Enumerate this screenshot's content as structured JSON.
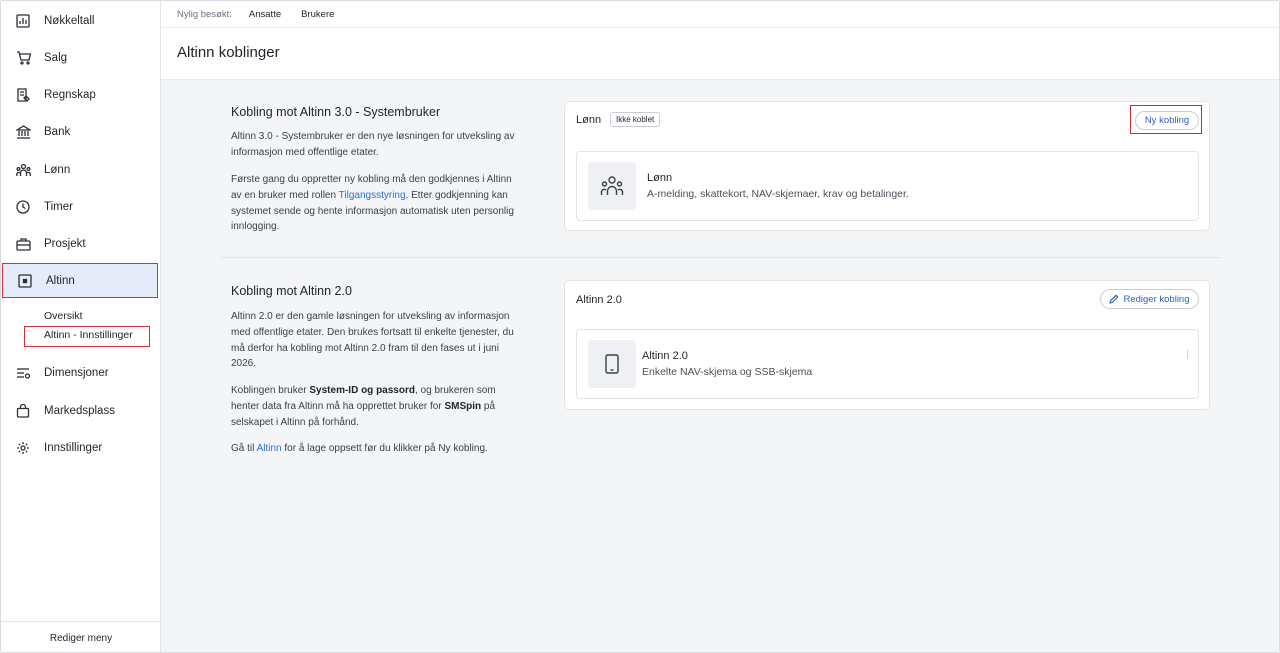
{
  "sidebar": {
    "items": [
      {
        "label": "Nøkkeltall",
        "icon": "bar-chart-icon"
      },
      {
        "label": "Salg",
        "icon": "cart-icon"
      },
      {
        "label": "Regnskap",
        "icon": "ledger-icon"
      },
      {
        "label": "Bank",
        "icon": "bank-icon"
      },
      {
        "label": "Lønn",
        "icon": "people-icon"
      },
      {
        "label": "Timer",
        "icon": "clock-icon"
      },
      {
        "label": "Prosjekt",
        "icon": "briefcase-icon"
      },
      {
        "label": "Altinn",
        "icon": "altinn-icon"
      },
      {
        "label": "Dimensjoner",
        "icon": "dimensions-icon"
      },
      {
        "label": "Markedsplass",
        "icon": "shopping-bag-icon"
      },
      {
        "label": "Innstillinger",
        "icon": "gear-icon"
      }
    ],
    "sub_items": [
      "Oversikt",
      "Altinn - Innstillinger"
    ],
    "footer": "Rediger meny"
  },
  "topbar": {
    "label": "Nylig besøkt:",
    "crumbs": [
      "Ansatte",
      "Brukere"
    ]
  },
  "page_title": "Altinn koblinger",
  "altinn3": {
    "title": "Kobling mot Altinn 3.0 - Systembruker",
    "p1": "Altinn 3.0 - Systembruker er den nye løsningen for utveksling av informasjon med offentlige etater.",
    "p2_before": "Første gang du oppretter ny kobling må den godkjennes i Altinn av en bruker med rollen ",
    "p2_link": "Tilgangsstyring",
    "p2_after": ". Etter godkjenning kan systemet sende og hente informasjon automatisk uten personlig innlogging.",
    "card": {
      "title": "Lønn",
      "badge": "Ikke koblet",
      "button": "Ny kobling",
      "item_title": "Lønn",
      "item_desc": "A-melding, skattekort, NAV-skjemaer, krav og betalinger."
    }
  },
  "altinn2": {
    "title": "Kobling mot Altinn 2.0",
    "p1": "Altinn 2.0 er den gamle løsningen for utveksling av informasjon med offentlige etater. Den brukes fortsatt til enkelte tjenester, du må derfor ha kobling mot Altinn 2.0 fram til den fases ut i juni 2026.",
    "p2_before": "Koblingen bruker ",
    "p2_bold1": "System-ID og passord",
    "p2_mid": ", og brukeren som henter data fra Altinn må ha opprettet bruker for ",
    "p2_bold2": "SMSpin",
    "p2_after": " på selskapet i Altinn på forhånd.",
    "p3_before": "Gå til ",
    "p3_link": "Altinn",
    "p3_after": " for å lage oppsett før du klikker på Ny kobling.",
    "card": {
      "title": "Altinn 2.0",
      "button": "Rediger kobling",
      "item_title": "Altinn 2.0",
      "item_desc": "Enkelte NAV-skjema og SSB-skjema"
    }
  },
  "colors": {
    "accent": "#2f6fd1",
    "highlight_border": "#d22f3a",
    "active_bg": "#e5ebf8"
  }
}
